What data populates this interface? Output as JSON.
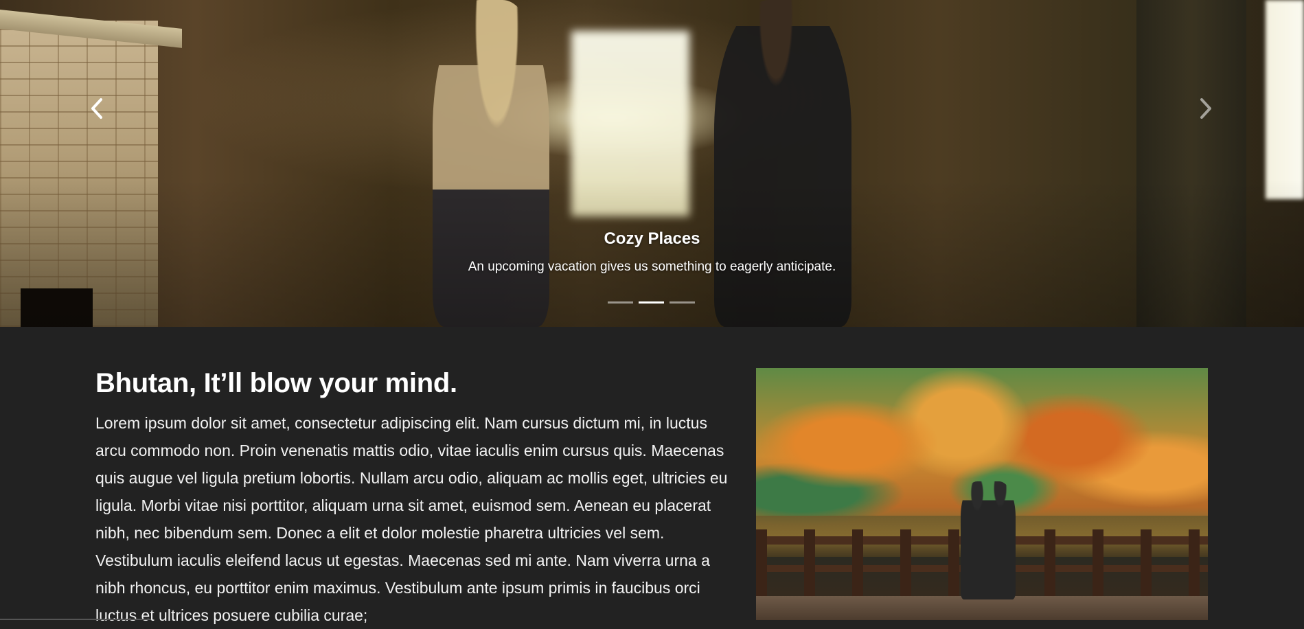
{
  "carousel": {
    "slide_title": "Cozy Places",
    "slide_text": "An upcoming vacation gives us something to eagerly anticipate.",
    "prev_icon": "chevron-left-icon",
    "next_icon": "chevron-right-icon",
    "indicator_count": 3,
    "active_index": 1
  },
  "intro": {
    "heading": "Bhutan, It’ll blow your mind.",
    "body": "Lorem ipsum dolor sit amet, consectetur adipiscing elit. Nam cursus dictum mi, in luctus arcu commodo non. Proin venenatis mattis odio, vitae iaculis enim cursus quis. Maecenas quis augue vel ligula pretium lobortis. Nullam arcu odio, aliquam ac mollis eget, ultricies eu ligula. Morbi vitae nisi porttitor, aliquam urna sit amet, euismod sem. Aenean eu placerat nibh, nec bibendum sem. Donec a elit et dolor molestie pharetra ultricies vel sem. Vestibulum iaculis eleifend lacus ut egestas. Maecenas sed mi ante. Nam viverra urna a nibh rhoncus, eu porttitor enim maximus. Vestibulum ante ipsum primis in faucibus orci luctus et ultrices posuere cubilia curae;"
  },
  "colors": {
    "page_background": "#222222",
    "text": "#ffffff"
  }
}
